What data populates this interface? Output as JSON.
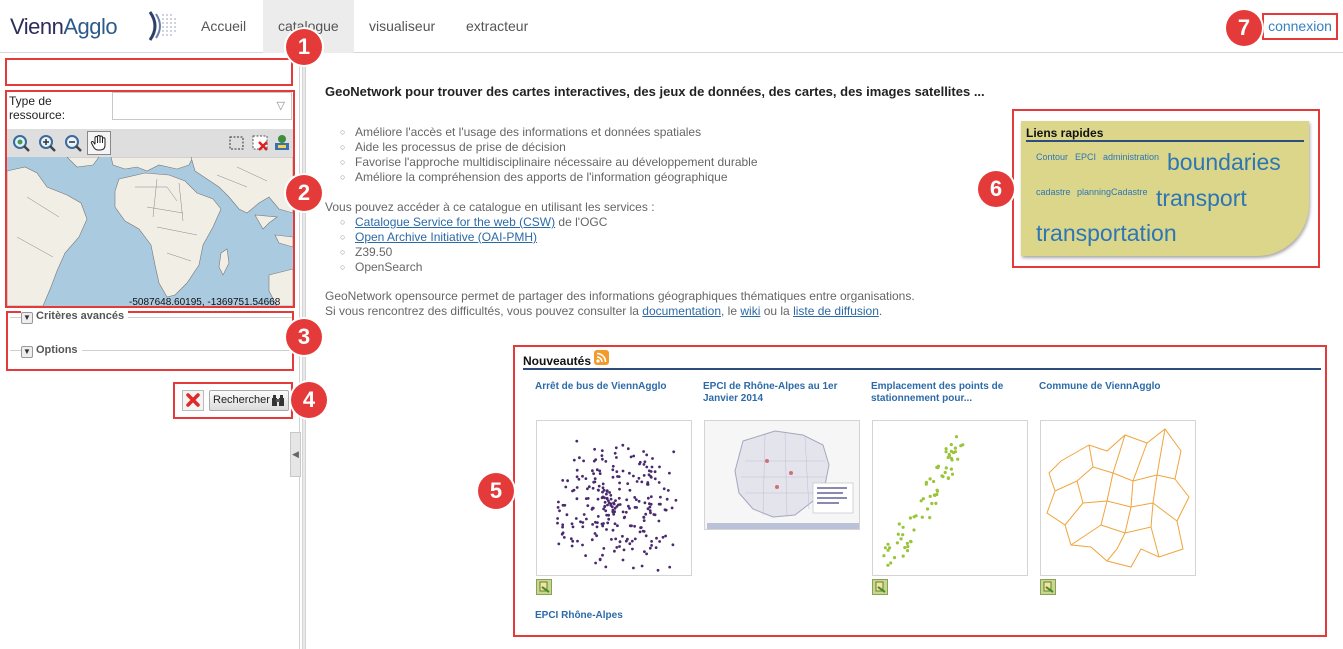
{
  "header": {
    "logo_text_a": "Vienn",
    "logo_text_b": "Agglo",
    "nav": [
      {
        "label": "Accueil"
      },
      {
        "label": "catalogue"
      },
      {
        "label": "visualiseur"
      },
      {
        "label": "extracteur"
      }
    ],
    "login_label": "connexion"
  },
  "markers": [
    "1",
    "2",
    "3",
    "4",
    "5",
    "6",
    "7"
  ],
  "search": {
    "keyword_value": "",
    "type_label": "Type de ressource:",
    "type_value": "",
    "map_coords": "-5087648.60195, -1369751.54668",
    "advanced_label": "Critères avancés",
    "options_label": "Options",
    "search_button_label": "Rechercher"
  },
  "intro": {
    "title": "GeoNetwork pour trouver des cartes interactives, des jeux de données, des cartes, des images satellites ...",
    "features": [
      "Améliore l'accès et l'usage des informations et données spatiales",
      "Aide les processus de prise de décision",
      "Favorise l'approche multidisciplinaire nécessaire au développement durable",
      "Améliore la compréhension des apports de l'information géographique"
    ],
    "services_intro": "Vous pouvez accéder à ce catalogue en utilisant les services :",
    "services": [
      {
        "link": "Catalogue Service for the web (CSW)",
        "suffix": " de l'OGC"
      },
      {
        "link": "Open Archive Initiative (OAI-PMH)",
        "suffix": ""
      },
      {
        "link": "",
        "suffix": "Z39.50"
      },
      {
        "link": "",
        "suffix": "OpenSearch"
      }
    ],
    "about_1": "GeoNetwork opensource permet de partager des informations géographiques thématiques entre organisations. Si vous rencontrez des difficultés, vous pouvez consulter la ",
    "about_link_doc": "documentation",
    "about_2": ", le ",
    "about_link_wiki": "wiki",
    "about_3": " ou la ",
    "about_link_list": "liste de diffusion",
    "about_4": "."
  },
  "quick_links": {
    "title": "Liens rapides",
    "tags": [
      {
        "label": "Contour"
      },
      {
        "label": "EPCI"
      },
      {
        "label": "administration"
      },
      {
        "label": "boundaries"
      },
      {
        "label": "cadastre"
      },
      {
        "label": "planningCadastre"
      },
      {
        "label": "transport"
      },
      {
        "label": "transportation"
      }
    ]
  },
  "news": {
    "title": "Nouveautés",
    "items": [
      {
        "title": "Arrêt de bus de ViennAgglo"
      },
      {
        "title": "EPCI de Rhône-Alpes au 1er Janvier 2014"
      },
      {
        "title": "Emplacement des points de stationnement pour..."
      },
      {
        "title": "Commune de ViennAgglo"
      },
      {
        "title": "EPCI Rhône-Alpes"
      }
    ]
  },
  "colors": {
    "annotation_red": "#e53a3a",
    "link_blue": "#2c6aa6",
    "quick_links_bg": "#dcd68b",
    "bus_dots": "#4a2a6e",
    "parking_dots": "#9ac43a",
    "commune_lines": "#f0a53c"
  }
}
